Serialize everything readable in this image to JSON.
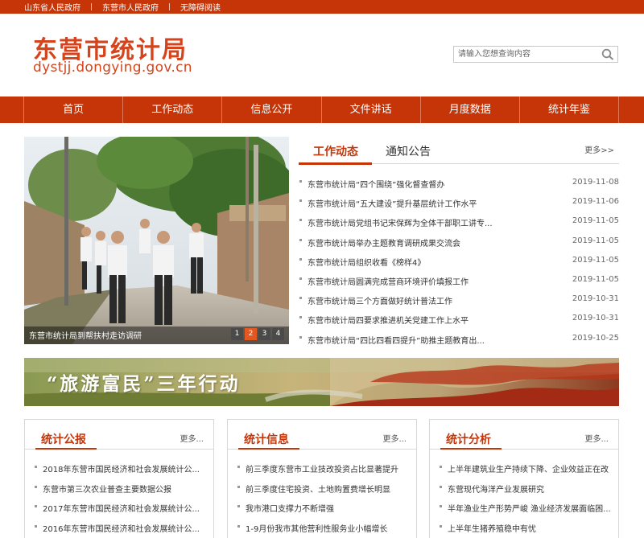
{
  "topbar": {
    "links": [
      "山东省人民政府",
      "东营市人民政府",
      "无障碍阅读"
    ]
  },
  "header": {
    "logo_cn": "东营市统计局",
    "logo_en": "dystjj.dongying.gov.cn",
    "search_placeholder": "请输入您想查询内容"
  },
  "nav": {
    "items": [
      "首页",
      "工作动态",
      "信息公开",
      "文件讲话",
      "月度数据",
      "统计年鉴"
    ]
  },
  "slider": {
    "caption": "东营市统计局到帮扶村走访调研",
    "pages": [
      "1",
      "2",
      "3",
      "4"
    ],
    "active_page": "2"
  },
  "news": {
    "tab_active": "工作动态",
    "tab_inactive": "通知公告",
    "more": "更多>>",
    "items": [
      {
        "title": "东营市统计局“四个围绕”强化督查督办",
        "date": "2019-11-08"
      },
      {
        "title": "东营市统计局“五大建设”提升基层统计工作水平",
        "date": "2019-11-06"
      },
      {
        "title": "东营市统计局党组书记宋保辉为全体干部职工讲专...",
        "date": "2019-11-05"
      },
      {
        "title": "东营市统计局举办主题教育调研成果交流会",
        "date": "2019-11-05"
      },
      {
        "title": "东营市统计局组织收看《榜样4》",
        "date": "2019-11-05"
      },
      {
        "title": "东营市统计局圆满完成营商环境评价填报工作",
        "date": "2019-11-05"
      },
      {
        "title": "东营市统计局三个方面做好统计普法工作",
        "date": "2019-10-31"
      },
      {
        "title": "东营市统计局四要求推进机关党建工作上水平",
        "date": "2019-10-31"
      },
      {
        "title": "东营市统计局“四比四看四提升”助推主题教育出...",
        "date": "2019-10-25"
      }
    ]
  },
  "banner": {
    "text": "“旅游富民”三年行动"
  },
  "cards": [
    {
      "title": "统计公报",
      "more": "更多...",
      "items": [
        "2018年东营市国民经济和社会发展统计公...",
        "东营市第三次农业普查主要数据公报",
        "2017年东营市国民经济和社会发展统计公...",
        "2016年东营市国民经济和社会发展统计公..."
      ]
    },
    {
      "title": "统计信息",
      "more": "更多...",
      "items": [
        "前三季度东营市工业技改投资占比显著提升",
        "前三季度住宅投资、土地购置费增长明显",
        "我市港口支撑力不断增强",
        "1-9月份我市其他营利性服务业小幅增长"
      ]
    },
    {
      "title": "统计分析",
      "more": "更多...",
      "items": [
        "上半年建筑业生产持续下降、企业效益正在改",
        "东营现代海洋产业发展研究",
        "半年渔业生产形势严峻 渔业经济发展面临困...",
        "上半年生猪养殖稳中有忧"
      ]
    }
  ],
  "colors": {
    "brand_red": "#c63508",
    "logo_red": "#d4451d",
    "active_dot": "#e4571f"
  }
}
